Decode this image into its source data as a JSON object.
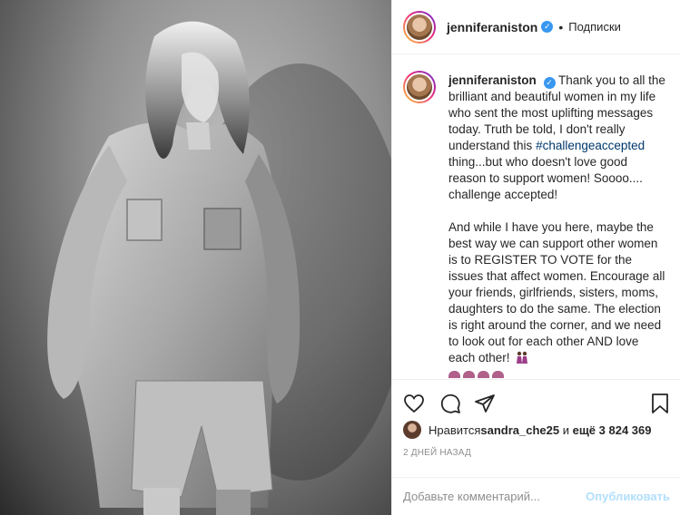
{
  "post": {
    "username": "jenniferaniston",
    "dot": "•",
    "follow_label": "Подписки"
  },
  "caption": {
    "username": "jenniferaniston",
    "text_1a": " Thank you to all the brilliant and beautiful women in my life who sent the most uplifting messages today. Truth be told, I don't really understand this ",
    "hashtag": "#challengeaccepted",
    "text_1b": " thing...but who doesn't love good reason to support women!  Soooo.... challenge accepted!",
    "text_2": "And while I have you here, maybe the best way we can support other women is to REGISTER TO VOTE for the issues that affect women. Encourage all your friends, girlfriends, sisters, moms, daughters to do the same. The election is right around the corner, and we need to look out for each other AND love each other!"
  },
  "likes": {
    "prefix": "Нравится ",
    "user": "sandra_che25",
    "middle": " и ",
    "count": "ещё 3 824 369"
  },
  "time_label": "2 ДНЕЙ НАЗАД",
  "comment": {
    "placeholder": "Добавьте комментарий...",
    "publish_label": "Опубликовать"
  },
  "icons": [
    "heart-icon",
    "comment-icon",
    "share-icon",
    "bookmark-icon",
    "verified-icon"
  ],
  "colors": {
    "verified": "#3897f0",
    "hashtag": "#00376b",
    "publish": "#b2dffc",
    "muted": "#8e8e8e"
  }
}
